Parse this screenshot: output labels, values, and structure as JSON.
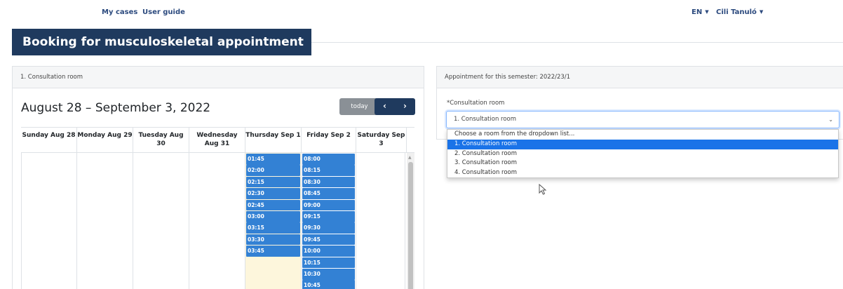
{
  "nav": {
    "my_cases": "My cases",
    "user_guide": "User guide",
    "language": "EN",
    "user": "Cili Tanuló"
  },
  "page_title": "Booking for musculoskeletal appointment",
  "calendar": {
    "panel_title": "1. Consultation room",
    "range": "August 28 – September 3, 2022",
    "today_label": "today",
    "prev_label": "‹",
    "next_label": "›",
    "days": [
      {
        "label": "Sunday Aug 28",
        "slots": []
      },
      {
        "label": "Monday Aug 29",
        "slots": []
      },
      {
        "label": "Tuesday Aug 30",
        "slots": []
      },
      {
        "label": "Wednesday Aug 31",
        "slots": []
      },
      {
        "label": "Thursday Sep 1",
        "slots": [
          "01:45",
          "02:00",
          "02:15",
          "02:30",
          "02:45",
          "03:00",
          "03:15",
          "03:30",
          "03:45"
        ]
      },
      {
        "label": "Friday Sep 2",
        "slots": [
          "08:00",
          "08:15",
          "08:30",
          "08:45",
          "09:00",
          "09:15",
          "09:30",
          "09:45",
          "10:00",
          "10:15",
          "10:30",
          "10:45"
        ]
      },
      {
        "label": "Saturday Sep 3",
        "slots": []
      }
    ]
  },
  "appointment": {
    "panel_title": "Appointment for this semester: 2022/23/1",
    "field_label": "*Consultation room",
    "selected_value": "1. Consultation room",
    "options": [
      "Choose a room from the dropdown list...",
      "1. Consultation room",
      "2. Consultation room",
      "3. Consultation room",
      "4. Consultation room"
    ],
    "highlighted_option": 1
  },
  "colors": {
    "brand": "#1f3a5e",
    "slot": "#3381d4",
    "today_highlight": "#fdf6dc",
    "option_highlight": "#1a73e8"
  }
}
